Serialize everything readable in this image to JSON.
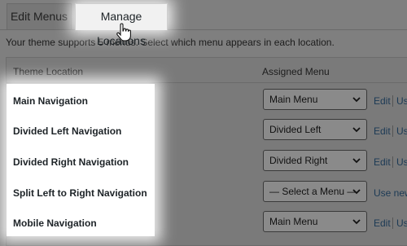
{
  "tabs": [
    {
      "label": "Edit Menus"
    },
    {
      "label": "Manage Locations"
    }
  ],
  "subtitle": "Your theme supports 5 menus. Select which menu appears in each location.",
  "table": {
    "headers": {
      "location": "Theme Location",
      "menu": "Assigned Menu"
    },
    "rows": [
      {
        "location": "Main Navigation",
        "menu": "Main Menu",
        "links": [
          "Edit",
          "Us"
        ]
      },
      {
        "location": "Divided Left Navigation",
        "menu": "Divided Left",
        "links": [
          "Edit",
          "Us"
        ]
      },
      {
        "location": "Divided Right Navigation",
        "menu": "Divided Right",
        "links": [
          "Edit",
          "Us"
        ]
      },
      {
        "location": "Split Left to Right Navigation",
        "menu": "— Select a Menu —",
        "links": [
          "Use new"
        ]
      },
      {
        "location": "Mobile Navigation",
        "menu": "Main Menu",
        "links": [
          "Edit",
          "Us"
        ]
      }
    ]
  },
  "icons": {
    "cursor": "hand-pointer-icon",
    "dropdown": "chevron-down-icon"
  },
  "colors": {
    "highlight": "#ffffff",
    "overlay": "#7f7f7f",
    "link": "#1c3a55"
  }
}
